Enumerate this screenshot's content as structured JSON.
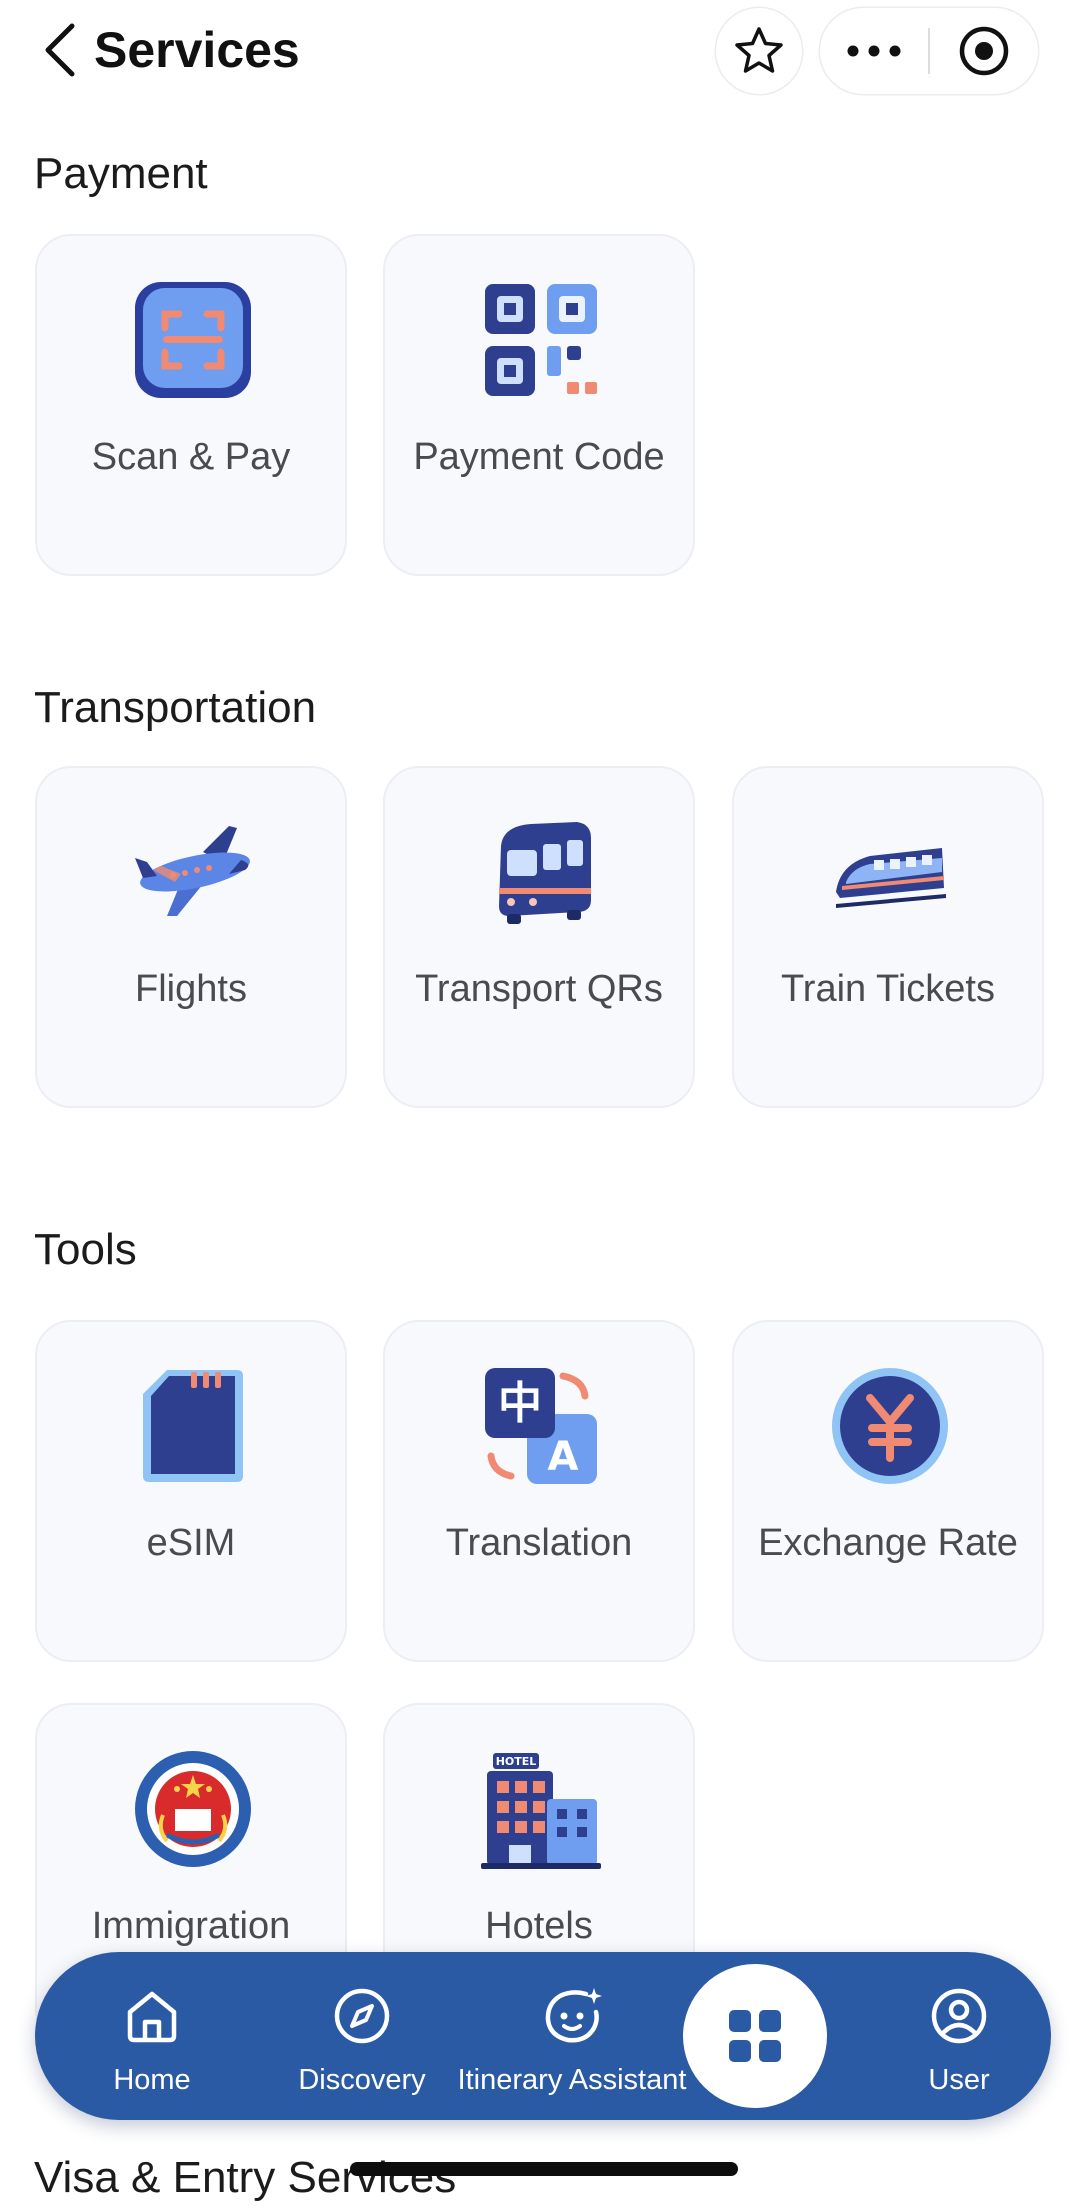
{
  "header": {
    "title": "Services",
    "back_icon": "chevron-left-icon",
    "favorite_icon": "star-icon",
    "more_icon": "more-dots-icon",
    "close_icon": "target-circle-icon"
  },
  "sections": [
    {
      "title": "Payment",
      "items": [
        {
          "label": "Scan & Pay",
          "icon": "scan-icon"
        },
        {
          "label": "Payment Code",
          "icon": "qr-code-icon"
        }
      ]
    },
    {
      "title": "Transportation",
      "items": [
        {
          "label": "Flights",
          "icon": "airplane-icon"
        },
        {
          "label": "Transport QRs",
          "icon": "subway-icon"
        },
        {
          "label": "Train Tickets",
          "icon": "train-icon"
        }
      ]
    },
    {
      "title": "Tools",
      "items": [
        {
          "label": "eSIM",
          "icon": "sim-card-icon"
        },
        {
          "label": "Translation",
          "icon": "translate-icon",
          "glyph_zh": "中",
          "glyph_en": "A"
        },
        {
          "label": "Exchange Rate",
          "icon": "yuan-coin-icon"
        },
        {
          "label": "Immigration",
          "icon": "immigration-emblem-icon"
        },
        {
          "label": "Hotels",
          "icon": "hotel-icon",
          "sign": "HOTEL"
        }
      ]
    },
    {
      "title": "Visa & Entry Services"
    }
  ],
  "bottom_nav": {
    "items": [
      {
        "label": "Home",
        "icon": "home-icon"
      },
      {
        "label": "Discovery",
        "icon": "compass-icon"
      },
      {
        "label": "Itinerary Assistant",
        "icon": "assistant-bot-icon"
      },
      {
        "label": "",
        "icon": "grid-apps-icon",
        "active": true
      },
      {
        "label": "User",
        "icon": "user-icon"
      }
    ]
  },
  "colors": {
    "nav_background": "#2b5aa4",
    "card_background": "#f8f9fc",
    "icon_primary": "#2f3f8f",
    "icon_accent": "#f08a72"
  }
}
